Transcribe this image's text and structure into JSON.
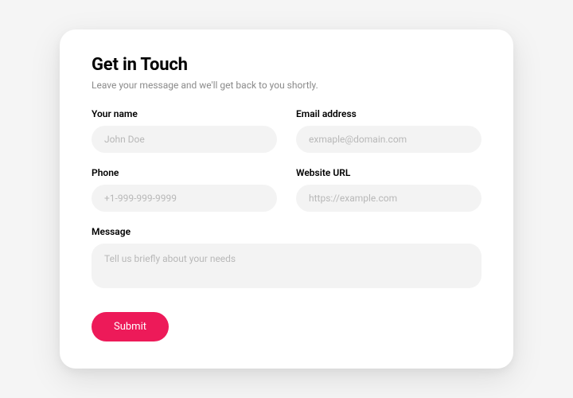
{
  "heading": "Get in Touch",
  "subheading": "Leave your message and we'll get back to you shortly.",
  "fields": {
    "name": {
      "label": "Your name",
      "placeholder": "John Doe"
    },
    "email": {
      "label": "Email address",
      "placeholder": "exmaple@domain.com"
    },
    "phone": {
      "label": "Phone",
      "placeholder": "+1-999-999-9999"
    },
    "website": {
      "label": "Website URL",
      "placeholder": "https://example.com"
    },
    "message": {
      "label": "Message",
      "placeholder": "Tell us briefly about your needs"
    }
  },
  "submit_label": "Submit",
  "colors": {
    "accent": "#ed1a59"
  }
}
